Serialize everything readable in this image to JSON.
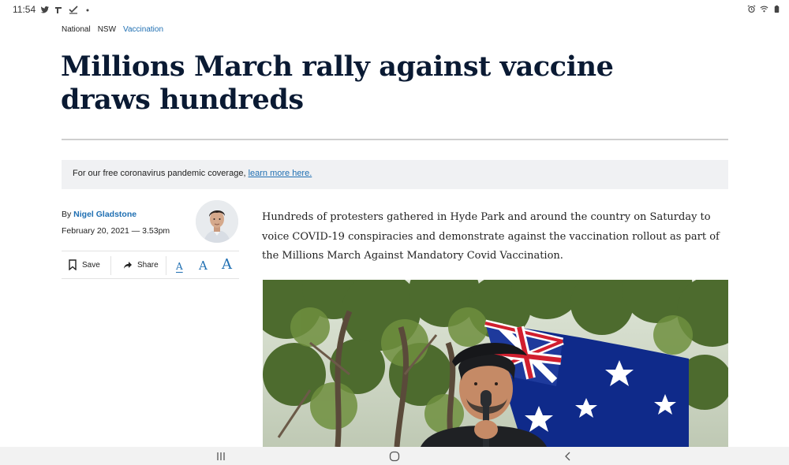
{
  "status_bar": {
    "time": "11:54",
    "left_icons": [
      "twitter-icon",
      "reply-icon",
      "check-icon",
      "dot-icon"
    ],
    "right_icons": [
      "alarm-icon",
      "wifi-icon",
      "battery-icon"
    ]
  },
  "breadcrumb": {
    "items": [
      "National",
      "NSW",
      "Vaccination"
    ]
  },
  "article": {
    "headline": "Millions March rally against vaccine draws hundreds",
    "banner_text": "For our free coronavirus pandemic coverage, ",
    "banner_link": "learn more here.",
    "byline_prefix": "By ",
    "author": "Nigel Gladstone",
    "date": "February 20, 2021 — 3.53pm",
    "lede": "Hundreds of protesters gathered in Hyde Park and around the country on Saturday to voice COVID-19 conspiracies and demonstrate against the vaccination rollout as part of the Millions March Against Mandatory Covid Vaccination."
  },
  "toolbar": {
    "save_label": "Save",
    "share_label": "Share",
    "font_small": "A",
    "font_medium": "A",
    "font_large": "A"
  },
  "colors": {
    "accent": "#1f6fb2",
    "headline": "#0a1a33",
    "banner_bg": "#f0f1f3"
  }
}
